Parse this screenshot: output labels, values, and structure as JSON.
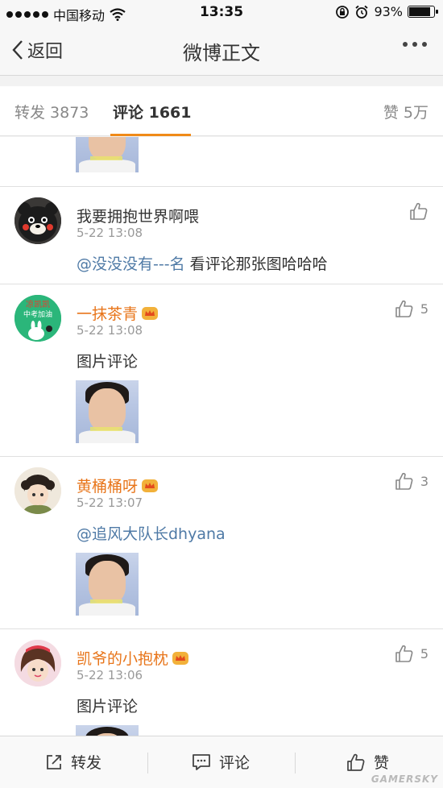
{
  "status_bar": {
    "carrier": "中国移动",
    "time": "13:35",
    "battery": "93%",
    "battery_level": 0.93
  },
  "nav": {
    "back_label": "返回",
    "title": "微博正文"
  },
  "tabs": [
    {
      "label": "转发 3873"
    },
    {
      "label": "评论 1661"
    },
    {
      "label": "赞 5万"
    }
  ],
  "comments": [
    {
      "name": "我要拥抱世界啊喂",
      "time": "5-22 13:08",
      "mention": "@没没没有---名",
      "text": " 看评论那张图哈哈哈",
      "likes": ""
    },
    {
      "name": "一抹茶青",
      "time": "5-22 13:08",
      "text": "图片评论",
      "likes": "5",
      "avatar_text_top": "凉凯凯",
      "avatar_text_bottom": "中考加油"
    },
    {
      "name": "黄桶桶呀",
      "time": "5-22 13:07",
      "mention": "@追风大队长dhyana",
      "likes": "3"
    },
    {
      "name": "凯爷的小抱枕",
      "time": "5-22 13:06",
      "text": "图片评论",
      "likes": "5"
    }
  ],
  "bottom_bar": {
    "repost_label": "转发",
    "comment_label": "评论",
    "like_label": "赞"
  },
  "watermark": "GAMERSKY",
  "colors": {
    "accent": "#f08a18",
    "vip_name": "#e8751a",
    "mention": "#4f7aa6"
  }
}
